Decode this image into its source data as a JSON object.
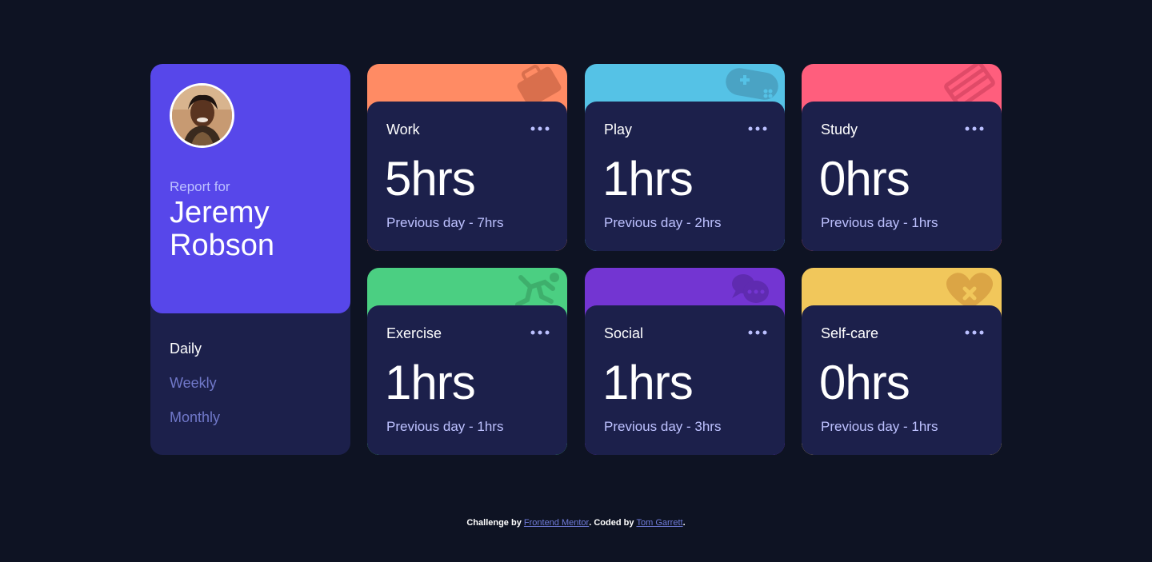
{
  "profile": {
    "report_label": "Report for",
    "name": "Jeremy Robson",
    "avatar_icon": "user-avatar-photo"
  },
  "periods": [
    {
      "label": "Daily",
      "active": true
    },
    {
      "label": "Weekly",
      "active": false
    },
    {
      "label": "Monthly",
      "active": false
    }
  ],
  "cards": [
    {
      "title": "Work",
      "current": "5hrs",
      "previous": "Previous day - 7hrs",
      "color": "#ff8b64",
      "icon": "briefcase-icon"
    },
    {
      "title": "Play",
      "current": "1hrs",
      "previous": "Previous day - 2hrs",
      "color": "#55c2e6",
      "icon": "gamepad-icon"
    },
    {
      "title": "Study",
      "current": "0hrs",
      "previous": "Previous day - 1hrs",
      "color": "#ff5e7d",
      "icon": "book-icon"
    },
    {
      "title": "Exercise",
      "current": "1hrs",
      "previous": "Previous day - 1hrs",
      "color": "#4bcf82",
      "icon": "runner-icon"
    },
    {
      "title": "Social",
      "current": "1hrs",
      "previous": "Previous day - 3hrs",
      "color": "#7335d2",
      "icon": "chat-bubbles-icon"
    },
    {
      "title": "Self-care",
      "current": "0hrs",
      "previous": "Previous day - 1hrs",
      "color": "#f1c75b",
      "icon": "heart-icon"
    }
  ],
  "footer": {
    "challenge_by": "Challenge by ",
    "frontend_mentor": "Frontend Mentor",
    "coded_by": ". Coded by ",
    "author": "Tom Garrett",
    "end": "."
  }
}
